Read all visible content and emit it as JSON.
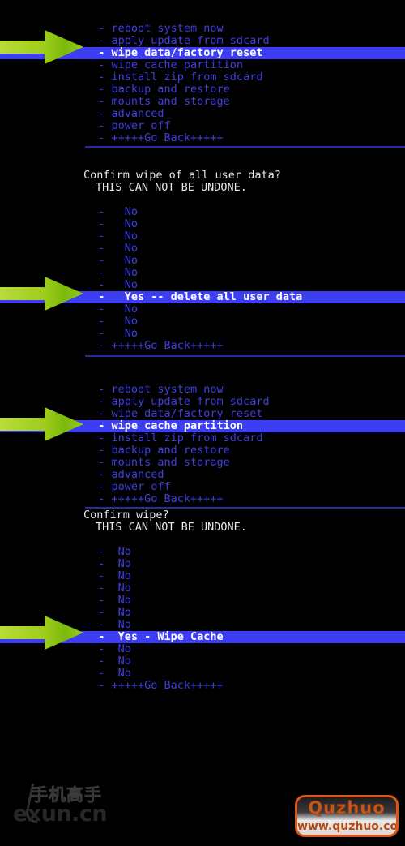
{
  "screen": {
    "background_color": "#000000",
    "text_color": "#3f3fe0",
    "header_text_color": "#e8e8e8",
    "highlight_bg_color": "#3d3df2",
    "highlight_text_color": "#ffffff",
    "separator_color": "#2b2b9e",
    "arrow_color": "#9ace1c"
  },
  "sections": [
    {
      "name": "main-menu-wipe-data",
      "rows": [
        {
          "text": "  - reboot system now",
          "selected": false
        },
        {
          "text": "  - apply update from sdcard",
          "selected": false
        },
        {
          "text": "  - wipe data/factory reset",
          "selected": true
        },
        {
          "text": "  - wipe cache partition",
          "selected": false
        },
        {
          "text": "  - install zip from sdcard",
          "selected": false
        },
        {
          "text": "  - backup and restore",
          "selected": false
        },
        {
          "text": "  - mounts and storage",
          "selected": false
        },
        {
          "text": "  - advanced",
          "selected": false
        },
        {
          "text": "  - power off",
          "selected": false
        },
        {
          "text": "  - +++++Go Back+++++",
          "selected": false
        }
      ]
    },
    {
      "name": "confirm-wipe-user-data",
      "header": "Confirm wipe of all user data?",
      "header2": "THIS CAN NOT BE UNDONE.",
      "rows": [
        {
          "text": "  -   No",
          "selected": false
        },
        {
          "text": "  -   No",
          "selected": false
        },
        {
          "text": "  -   No",
          "selected": false
        },
        {
          "text": "  -   No",
          "selected": false
        },
        {
          "text": "  -   No",
          "selected": false
        },
        {
          "text": "  -   No",
          "selected": false
        },
        {
          "text": "  -   No",
          "selected": false
        },
        {
          "text": "  -   Yes -- delete all user data",
          "selected": true
        },
        {
          "text": "  -   No",
          "selected": false
        },
        {
          "text": "  -   No",
          "selected": false
        },
        {
          "text": "  -   No",
          "selected": false
        },
        {
          "text": "  - +++++Go Back+++++",
          "selected": false
        }
      ]
    },
    {
      "name": "main-menu-wipe-cache",
      "rows": [
        {
          "text": "  - reboot system now",
          "selected": false
        },
        {
          "text": "  - apply update from sdcard",
          "selected": false
        },
        {
          "text": "  - wipe data/factory reset",
          "selected": false
        },
        {
          "text": "  - wipe cache partition",
          "selected": true
        },
        {
          "text": "  - install zip from sdcard",
          "selected": false
        },
        {
          "text": "  - backup and restore",
          "selected": false
        },
        {
          "text": "  - mounts and storage",
          "selected": false
        },
        {
          "text": "  - advanced",
          "selected": false
        },
        {
          "text": "  - power off",
          "selected": false
        },
        {
          "text": "  - +++++Go Back+++++",
          "selected": false
        }
      ]
    },
    {
      "name": "confirm-wipe-cache",
      "header": "Confirm wipe?",
      "header2": "THIS CAN NOT BE UNDONE.",
      "rows": [
        {
          "text": "  -  No",
          "selected": false
        },
        {
          "text": "  -  No",
          "selected": false
        },
        {
          "text": "  -  No",
          "selected": false
        },
        {
          "text": "  -  No",
          "selected": false
        },
        {
          "text": "  -  No",
          "selected": false
        },
        {
          "text": "  -  No",
          "selected": false
        },
        {
          "text": "  -  No",
          "selected": false
        },
        {
          "text": "  -  Yes - Wipe Cache",
          "selected": true
        },
        {
          "text": "  -  No",
          "selected": false
        },
        {
          "text": "  -  No",
          "selected": false
        },
        {
          "text": "  -  No",
          "selected": false
        },
        {
          "text": "  - +++++Go Back+++++",
          "selected": false
        }
      ]
    }
  ],
  "annotations": {
    "arrows": [
      {
        "name": "arrow-wipe-data-factory-reset",
        "target": "wipe data/factory reset"
      },
      {
        "name": "arrow-yes-delete-all-user-data",
        "target": "Yes -- delete all user data"
      },
      {
        "name": "arrow-wipe-cache-partition",
        "target": "wipe cache partition"
      },
      {
        "name": "arrow-yes-wipe-cache",
        "target": "Yes - Wipe Cache"
      }
    ]
  },
  "watermarks": {
    "lexun": {
      "cn_text": "手机高手",
      "latin_text": "exun.cn"
    },
    "quzhuo": {
      "brand": "Quzhuo",
      "url": "www.quzhuo.com"
    }
  }
}
